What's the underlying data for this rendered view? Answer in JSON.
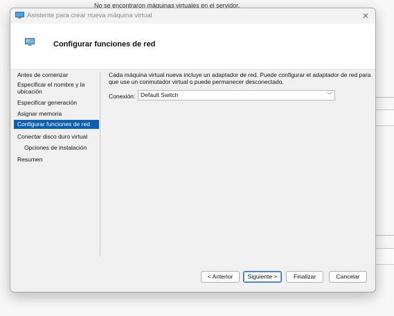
{
  "background": {
    "status_text": "No se encontraron máquinas virtuales en el servidor."
  },
  "window": {
    "title": "Asistente para crear nueva máquina virtual",
    "close_glyph": "✕"
  },
  "header": {
    "title": "Configurar funciones de red"
  },
  "sidebar": {
    "items": [
      {
        "label": "Antes de comenzar"
      },
      {
        "label": "Especificar el nombre y la ubicación"
      },
      {
        "label": "Especificar generación"
      },
      {
        "label": "Asignar memoria"
      },
      {
        "label": "Configurar funciones de red"
      },
      {
        "label": "Conectar disco duro virtual"
      },
      {
        "label": "Opciones de instalación"
      },
      {
        "label": "Resumen"
      }
    ]
  },
  "main": {
    "description": "Cada máquina virtual nueva incluye un adaptador de red. Puede configurar el adaptador de red para que use un conmutador virtual o puede permanecer desconectado.",
    "connection_label": "Conexión:",
    "connection_value": "Default Switch",
    "chevron_glyph": "﹀"
  },
  "footer": {
    "previous_label": "< Anterior",
    "next_label": "Siguiente >",
    "finish_label": "Finalizar",
    "cancel_label": "Cancelar"
  },
  "colors": {
    "accent": "#0a5fb4"
  }
}
